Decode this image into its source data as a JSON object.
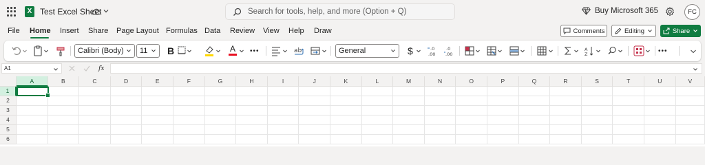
{
  "titlebar": {
    "doc_title": "Test Excel Sheet",
    "search_placeholder": "Search for tools, help, and more (Option + Q)",
    "buy_label": "Buy Microsoft 365",
    "avatar_initials": "FC"
  },
  "tabs": [
    "File",
    "Home",
    "Insert",
    "Share",
    "Page Layout",
    "Formulas",
    "Data",
    "Review",
    "View",
    "Help",
    "Draw"
  ],
  "active_tab": "Home",
  "actions": {
    "comments": "Comments",
    "editing": "Editing",
    "share": "Share"
  },
  "ribbon": {
    "font_name": "Calibri (Body)",
    "font_size": "11",
    "number_format": "General",
    "currency_symbol": "$",
    "bold_label": "B",
    "font_color_label": "A",
    "more_label": "•••"
  },
  "formula_bar": {
    "name_box": "A1",
    "fx_label": "fx",
    "formula_value": ""
  },
  "sheet": {
    "columns": [
      "A",
      "B",
      "C",
      "D",
      "E",
      "F",
      "G",
      "H",
      "I",
      "J",
      "K",
      "L",
      "M",
      "N",
      "O",
      "P",
      "Q",
      "R",
      "S",
      "T",
      "U",
      "V"
    ],
    "rows": [
      "1",
      "2",
      "3",
      "4",
      "5",
      "6"
    ],
    "selected_cell": "A1"
  },
  "colors": {
    "accent": "#107c41",
    "highlight": "#ffd700",
    "font_color": "#e81123"
  }
}
